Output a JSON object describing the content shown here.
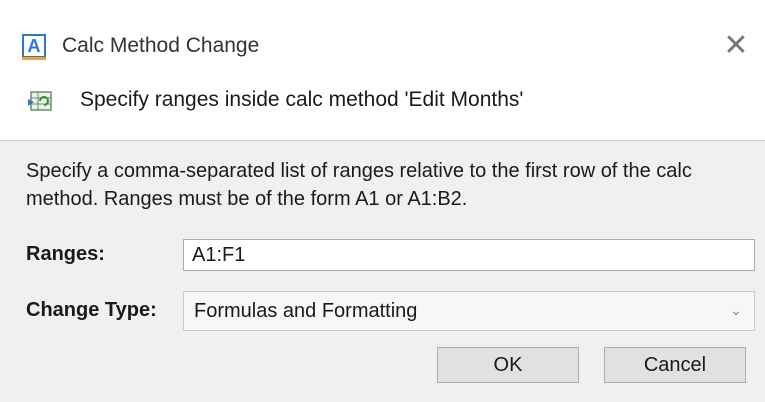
{
  "window": {
    "title": "Calc Method Change",
    "app_icon_letter": "A",
    "close_glyph": "✕"
  },
  "header": {
    "icon": "calc-refresh-icon",
    "text": "Specify ranges inside calc method 'Edit Months'"
  },
  "body": {
    "description": "Specify a comma-separated list of ranges relative to the first row of the calc method. Ranges must be of the form A1 or A1:B2.",
    "ranges_label": "Ranges:",
    "ranges_value": "A1:F1",
    "change_type_label": "Change Type:",
    "change_type_value": "Formulas and Formatting",
    "chevron_glyph": "⌄"
  },
  "buttons": {
    "ok": "OK",
    "cancel": "Cancel"
  },
  "colors": {
    "accent": "#2b78d4",
    "icon_orange": "#f0a030",
    "dialog_bg": "#f0f0f0"
  }
}
